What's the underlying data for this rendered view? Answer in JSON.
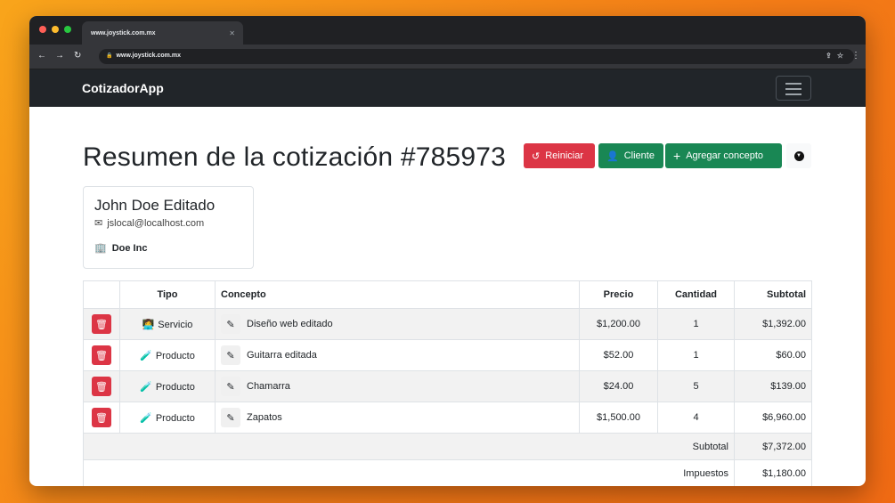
{
  "browser": {
    "tab_title": "www.joystick.com.mx",
    "url": "www.joystick.com.mx"
  },
  "app": {
    "brand": "CotizadorApp"
  },
  "page": {
    "title": "Resumen de la cotización #785973"
  },
  "actions": {
    "reset_label": "Reiniciar",
    "client_label": "Cliente",
    "add_label": "Agregar concepto"
  },
  "client": {
    "name": "John Doe Editado",
    "email": "jslocal@localhost.com",
    "company": "Doe Inc"
  },
  "table": {
    "headers": {
      "tipo": "Tipo",
      "concepto": "Concepto",
      "precio": "Precio",
      "cantidad": "Cantidad",
      "subtotal": "Subtotal"
    },
    "rows": [
      {
        "tipo": "Servicio",
        "concepto": "Diseño web editado",
        "precio": "$1,200.00",
        "cantidad": "1",
        "subtotal": "$1,392.00"
      },
      {
        "tipo": "Producto",
        "concepto": "Guitarra editada",
        "precio": "$52.00",
        "cantidad": "1",
        "subtotal": "$60.00"
      },
      {
        "tipo": "Producto",
        "concepto": "Chamarra",
        "precio": "$24.00",
        "cantidad": "5",
        "subtotal": "$139.00"
      },
      {
        "tipo": "Producto",
        "concepto": "Zapatos",
        "precio": "$1,500.00",
        "cantidad": "4",
        "subtotal": "$6,960.00"
      }
    ],
    "footer": {
      "subtotal_label": "Subtotal",
      "subtotal_value": "$7,372.00",
      "taxes_label": "Impuestos",
      "taxes_value": "$1,180.00"
    }
  },
  "icons": {
    "servicio": "woman-technologist-icon",
    "producto": "test-tube-icon"
  },
  "colors": {
    "danger": "#dc3545",
    "success": "#198754",
    "navbar": "#212529"
  }
}
